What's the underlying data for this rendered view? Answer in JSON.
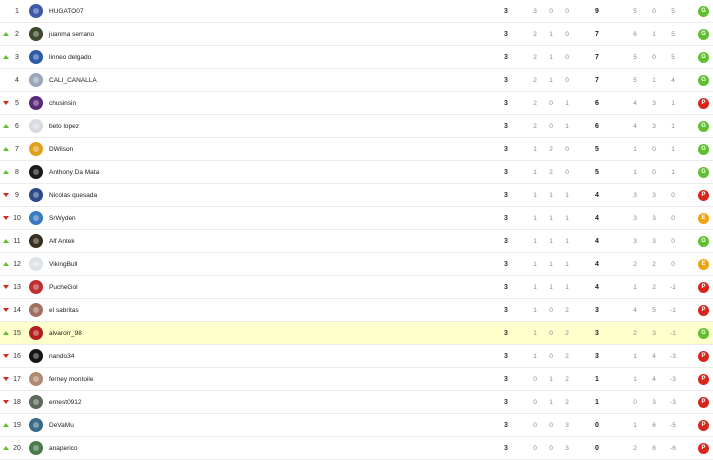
{
  "colors": {
    "win": "#5fbf2f",
    "loss": "#d9261c",
    "draw": "#f0a30a",
    "highlight": "#ffffcc"
  },
  "rows": [
    {
      "pos": "1",
      "trend": "none",
      "name": "HUGATO07",
      "pj": "3",
      "g": "3",
      "e": "0",
      "p": "0",
      "pts": "9",
      "gf": "5",
      "gc": "0",
      "dg": "5",
      "res": "G",
      "avatar": "#3c5aa8"
    },
    {
      "pos": "2",
      "trend": "up",
      "name": "juanma serrano",
      "pj": "3",
      "g": "2",
      "e": "1",
      "p": "0",
      "pts": "7",
      "gf": "6",
      "gc": "1",
      "dg": "5",
      "res": "G",
      "avatar": "#3d4a2c"
    },
    {
      "pos": "3",
      "trend": "up",
      "name": "linneo delgado",
      "pj": "3",
      "g": "2",
      "e": "1",
      "p": "0",
      "pts": "7",
      "gf": "5",
      "gc": "0",
      "dg": "5",
      "res": "G",
      "avatar": "#2e5aa8"
    },
    {
      "pos": "4",
      "trend": "none",
      "name": "CALI_CANALLA",
      "pj": "3",
      "g": "2",
      "e": "1",
      "p": "0",
      "pts": "7",
      "gf": "5",
      "gc": "1",
      "dg": "4",
      "res": "G",
      "avatar": "#9aa6b8"
    },
    {
      "pos": "5",
      "trend": "down",
      "name": "chusinsin",
      "pj": "3",
      "g": "2",
      "e": "0",
      "p": "1",
      "pts": "6",
      "gf": "4",
      "gc": "3",
      "dg": "1",
      "res": "P",
      "avatar": "#5a2a7a"
    },
    {
      "pos": "6",
      "trend": "up",
      "name": "beto lopez",
      "pj": "3",
      "g": "2",
      "e": "0",
      "p": "1",
      "pts": "6",
      "gf": "4",
      "gc": "3",
      "dg": "1",
      "res": "G",
      "avatar": "#d8dbe0"
    },
    {
      "pos": "7",
      "trend": "up",
      "name": "DWilson",
      "pj": "3",
      "g": "1",
      "e": "2",
      "p": "0",
      "pts": "5",
      "gf": "1",
      "gc": "0",
      "dg": "1",
      "res": "G",
      "avatar": "#e0a020"
    },
    {
      "pos": "8",
      "trend": "up",
      "name": "Anthony Da Mata",
      "pj": "3",
      "g": "1",
      "e": "2",
      "p": "0",
      "pts": "5",
      "gf": "1",
      "gc": "0",
      "dg": "1",
      "res": "G",
      "avatar": "#1a1a1a"
    },
    {
      "pos": "9",
      "trend": "down",
      "name": "Nicolas quesada",
      "pj": "3",
      "g": "1",
      "e": "1",
      "p": "1",
      "pts": "4",
      "gf": "3",
      "gc": "3",
      "dg": "0",
      "res": "P",
      "avatar": "#2c4a8a"
    },
    {
      "pos": "10",
      "trend": "down",
      "name": "SrWyden",
      "pj": "3",
      "g": "1",
      "e": "1",
      "p": "1",
      "pts": "4",
      "gf": "3",
      "gc": "3",
      "dg": "0",
      "res": "E",
      "avatar": "#3a7ac0"
    },
    {
      "pos": "11",
      "trend": "up",
      "name": "Alf Antek",
      "pj": "3",
      "g": "1",
      "e": "1",
      "p": "1",
      "pts": "4",
      "gf": "3",
      "gc": "3",
      "dg": "0",
      "res": "G",
      "avatar": "#3a3020"
    },
    {
      "pos": "12",
      "trend": "up",
      "name": "VikingBull",
      "pj": "3",
      "g": "1",
      "e": "1",
      "p": "1",
      "pts": "4",
      "gf": "2",
      "gc": "2",
      "dg": "0",
      "res": "E",
      "avatar": "#dfe2e6"
    },
    {
      "pos": "13",
      "trend": "down",
      "name": "PucheGol",
      "pj": "3",
      "g": "1",
      "e": "1",
      "p": "1",
      "pts": "4",
      "gf": "1",
      "gc": "2",
      "dg": "-1",
      "res": "P",
      "avatar": "#c03030"
    },
    {
      "pos": "14",
      "trend": "down",
      "name": "el sabritas",
      "pj": "3",
      "g": "1",
      "e": "0",
      "p": "2",
      "pts": "3",
      "gf": "4",
      "gc": "5",
      "dg": "-1",
      "res": "P",
      "avatar": "#a07060"
    },
    {
      "pos": "15",
      "trend": "up",
      "name": "alvarorr_98",
      "pj": "3",
      "g": "1",
      "e": "0",
      "p": "2",
      "pts": "3",
      "gf": "2",
      "gc": "3",
      "dg": "-1",
      "res": "G",
      "avatar": "#b02020",
      "highlight": true
    },
    {
      "pos": "16",
      "trend": "down",
      "name": "nando34",
      "pj": "3",
      "g": "1",
      "e": "0",
      "p": "2",
      "pts": "3",
      "gf": "1",
      "gc": "4",
      "dg": "-3",
      "res": "P",
      "avatar": "#151515"
    },
    {
      "pos": "17",
      "trend": "down",
      "name": "ferney montoile",
      "pj": "3",
      "g": "0",
      "e": "1",
      "p": "2",
      "pts": "1",
      "gf": "1",
      "gc": "4",
      "dg": "-3",
      "res": "P",
      "avatar": "#b08a70"
    },
    {
      "pos": "18",
      "trend": "down",
      "name": "ernest0912",
      "pj": "3",
      "g": "0",
      "e": "1",
      "p": "2",
      "pts": "1",
      "gf": "0",
      "gc": "3",
      "dg": "-3",
      "res": "P",
      "avatar": "#5a6a5a"
    },
    {
      "pos": "19",
      "trend": "up",
      "name": "DeVaMu",
      "pj": "3",
      "g": "0",
      "e": "0",
      "p": "3",
      "pts": "0",
      "gf": "1",
      "gc": "6",
      "dg": "-5",
      "res": "P",
      "avatar": "#3a6a8a"
    },
    {
      "pos": "20",
      "trend": "up",
      "name": "anaperico",
      "pj": "3",
      "g": "0",
      "e": "0",
      "p": "3",
      "pts": "0",
      "gf": "2",
      "gc": "8",
      "dg": "-6",
      "res": "P",
      "avatar": "#4a7a4a"
    }
  ]
}
